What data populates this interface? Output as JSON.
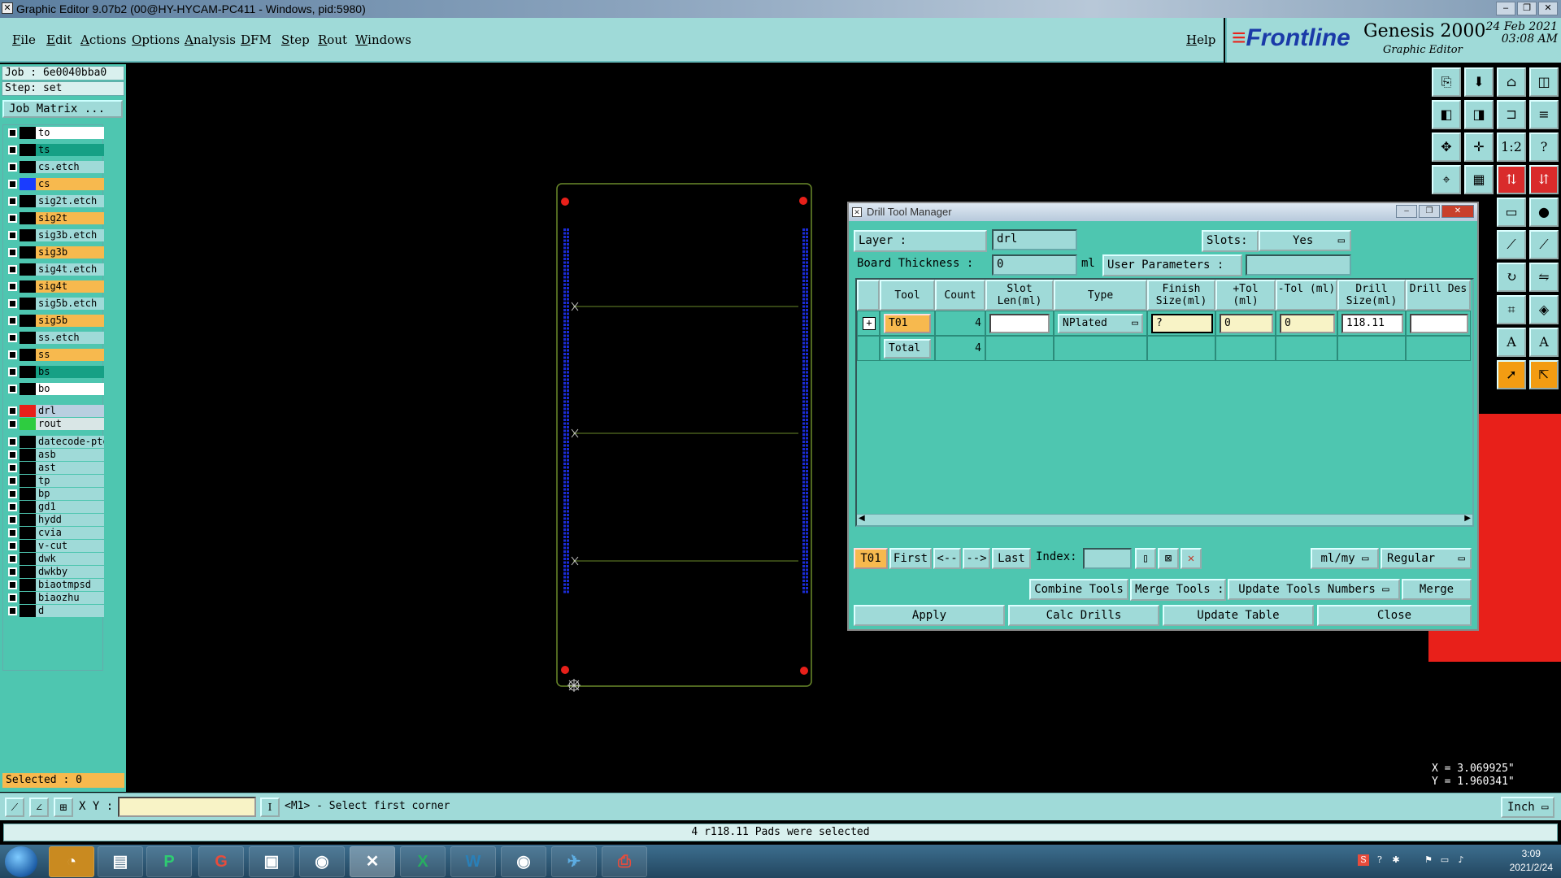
{
  "window": {
    "title": "Graphic Editor 9.07b2 (00@HY-HYCAM-PC411 - Windows, pid:5980)"
  },
  "menu": {
    "items": [
      "File",
      "Edit",
      "Actions",
      "Options",
      "Analysis",
      "DFM",
      "Step",
      "Rout",
      "Windows"
    ],
    "help": "Help"
  },
  "branding": {
    "logo": "Frontline",
    "product": "Genesis 2000",
    "subtitle": "Graphic Editor",
    "date": "24 Feb 2021",
    "time": "03:08 AM"
  },
  "left_panel": {
    "job": "Job : 6e0040bba0",
    "step": "Step: set",
    "job_matrix": "Job Matrix ...",
    "selected": "Selected : 0",
    "layers": [
      {
        "name": "to",
        "color": "#ffffff",
        "swatch": "#000000"
      },
      {
        "name": "ts",
        "color": "#16a085",
        "swatch": "#000000"
      },
      {
        "name": "cs.etch",
        "color": "#9fdad8",
        "swatch": "#000000"
      },
      {
        "name": "cs",
        "color": "#f7b94e",
        "swatch": "#1a3cff"
      },
      {
        "name": "sig2t.etch",
        "color": "#9fdad8",
        "swatch": "#000000"
      },
      {
        "name": "sig2t",
        "color": "#f7b94e",
        "swatch": "#000000"
      },
      {
        "name": "sig3b.etch",
        "color": "#9fdad8",
        "swatch": "#000000"
      },
      {
        "name": "sig3b",
        "color": "#f7b94e",
        "swatch": "#000000"
      },
      {
        "name": "sig4t.etch",
        "color": "#9fdad8",
        "swatch": "#000000"
      },
      {
        "name": "sig4t",
        "color": "#f7b94e",
        "swatch": "#000000"
      },
      {
        "name": "sig5b.etch",
        "color": "#9fdad8",
        "swatch": "#000000"
      },
      {
        "name": "sig5b",
        "color": "#f7b94e",
        "swatch": "#000000"
      },
      {
        "name": "ss.etch",
        "color": "#9fdad8",
        "swatch": "#000000"
      },
      {
        "name": "ss",
        "color": "#f7b94e",
        "swatch": "#000000"
      },
      {
        "name": "bs",
        "color": "#16a085",
        "swatch": "#000000"
      },
      {
        "name": "bo",
        "color": "#ffffff",
        "swatch": "#000000"
      },
      {
        "name": "drl",
        "color": "#b9cfe0",
        "swatch": "#e8201a"
      },
      {
        "name": "rout",
        "color": "#d9e6e6",
        "swatch": "#2ecc40"
      },
      {
        "name": "datecode-pto",
        "color": "#9fdad8",
        "swatch": "#000000"
      },
      {
        "name": "asb",
        "color": "#9fdad8",
        "swatch": "#000000"
      },
      {
        "name": "ast",
        "color": "#9fdad8",
        "swatch": "#000000"
      },
      {
        "name": "tp",
        "color": "#9fdad8",
        "swatch": "#000000"
      },
      {
        "name": "bp",
        "color": "#9fdad8",
        "swatch": "#000000"
      },
      {
        "name": "gd1",
        "color": "#9fdad8",
        "swatch": "#000000"
      },
      {
        "name": "hydd",
        "color": "#9fdad8",
        "swatch": "#000000"
      },
      {
        "name": "cvia",
        "color": "#9fdad8",
        "swatch": "#000000"
      },
      {
        "name": "v-cut",
        "color": "#9fdad8",
        "swatch": "#000000"
      },
      {
        "name": "dwk",
        "color": "#9fdad8",
        "swatch": "#000000"
      },
      {
        "name": "dwkby",
        "color": "#9fdad8",
        "swatch": "#000000"
      },
      {
        "name": "biaotmpsd",
        "color": "#9fdad8",
        "swatch": "#000000"
      },
      {
        "name": "biaozhu",
        "color": "#9fdad8",
        "swatch": "#000000"
      },
      {
        "name": "d",
        "color": "#9fdad8",
        "swatch": "#000000"
      }
    ]
  },
  "dialog": {
    "title": "Drill Tool Manager",
    "layer_label": "Layer :",
    "layer_value": "drl",
    "slots_label": "Slots:",
    "slots_value": "Yes",
    "thickness_label": "Board Thickness :",
    "thickness_value": "0",
    "thickness_unit": "ml",
    "user_params_label": "User Parameters :",
    "user_params_value": "",
    "columns": [
      "Tool",
      "Count",
      "Slot Len(ml)",
      "Type",
      "Finish Size(ml)",
      "+Tol (ml)",
      "-Tol (ml)",
      "Drill Size(ml)",
      "Drill Des"
    ],
    "rows": [
      {
        "tool": "T01",
        "count": "4",
        "slot_len": "",
        "type": "NPlated",
        "finish_size": "?",
        "plus_tol": "0",
        "minus_tol": "0",
        "drill_size": "118.11",
        "drill_des": ""
      }
    ],
    "total_label": "Total",
    "total_count": "4",
    "nav": {
      "current": "T01",
      "first": "First",
      "prev": "<--",
      "next": "-->",
      "last": "Last",
      "index_label": "Index:",
      "index_value": "",
      "units": "ml/my",
      "mode": "Regular"
    },
    "combine_tools": "Combine Tools",
    "merge_tools_label": "Merge Tools :",
    "merge_option": "Update Tools Numbers",
    "merge": "Merge",
    "apply": "Apply",
    "calc_drills": "Calc Drills",
    "update_table": "Update Table",
    "close": "Close"
  },
  "readout": {
    "x": "X = 3.069925\"",
    "y": "Y = 1.960341\""
  },
  "command": {
    "xy_label": "X Y :",
    "xy_value": "",
    "prompt": "<M1> - Select first corner",
    "unit": "Inch"
  },
  "status": {
    "message": "4 r118.11 Pads were selected"
  },
  "taskbar": {
    "time": "3:09",
    "date": "2021/2/24"
  },
  "colors": {
    "panel": "#4ec6b0",
    "panel_light": "#9fdad8",
    "highlight": "#f7b94e",
    "drill_pad": "#e8201a",
    "rout_outline": "#6a8a2a",
    "pads": "#1a2bd6"
  }
}
